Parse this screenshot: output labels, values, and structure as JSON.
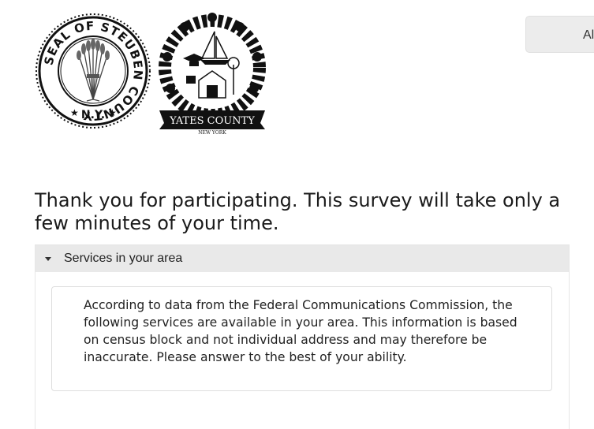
{
  "logos": {
    "steuben_seal": {
      "icon": "seal-of-steuben-county-logo",
      "ring_text": "SEAL OF STEUBEN COUNTY",
      "bottom_text": "N.Y."
    },
    "yates_county": {
      "icon": "yates-county-logo",
      "banner_text": "YATES COUNTY",
      "sub_text": "NEW YORK"
    }
  },
  "top_button": {
    "label": "Al"
  },
  "intro": {
    "text": "Thank you for participating. This survey will take only a few minutes of your time."
  },
  "section": {
    "title": "Services in your area",
    "notice": "According to data from the Federal Communications Commission, the following services are available in your area. This information is based on census block and not individual address and may therefore be inaccurate. Please answer to the best of your ability."
  }
}
